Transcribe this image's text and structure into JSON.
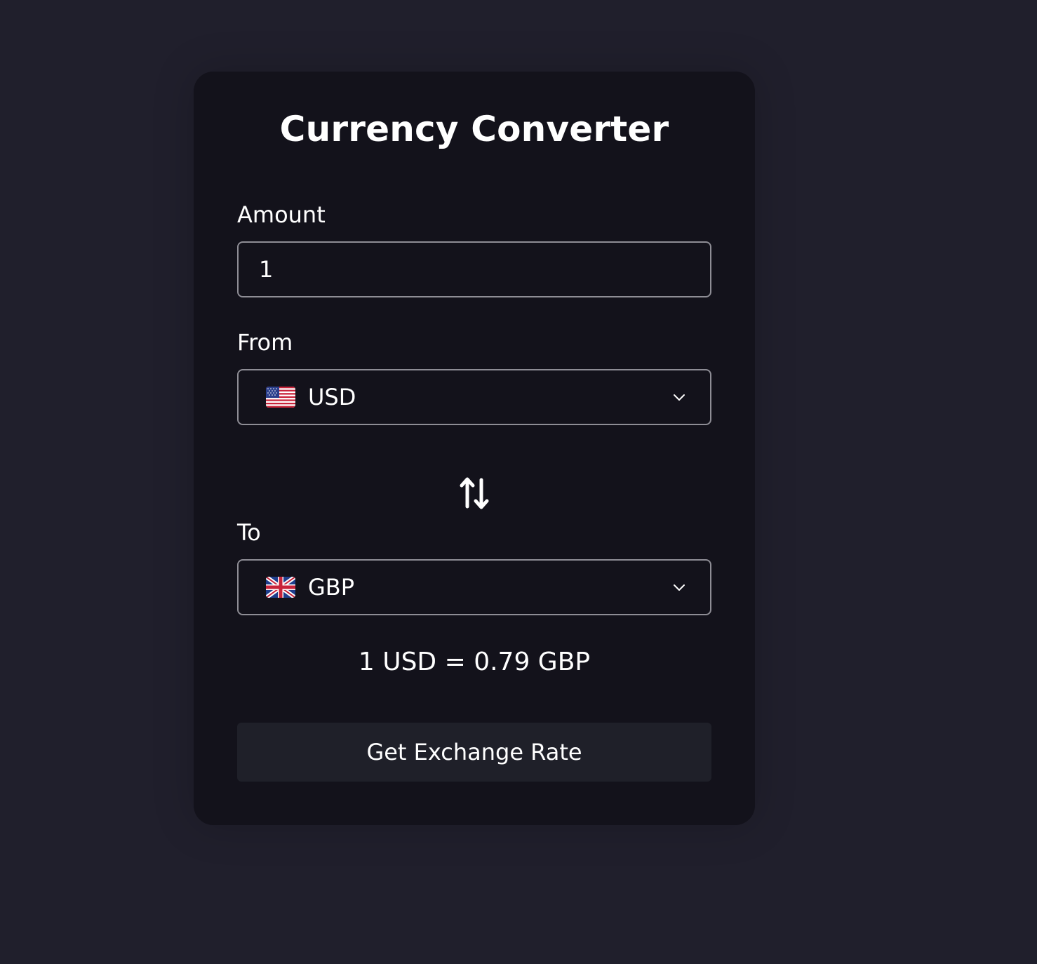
{
  "converter": {
    "title": "Currency Converter",
    "amount_label": "Amount",
    "amount_value": "1",
    "from_label": "From",
    "from_currency": "USD",
    "from_flag": "us-flag-icon",
    "to_label": "To",
    "to_currency": "GBP",
    "to_flag": "uk-flag-icon",
    "swap_icon": "swap-vertical-icon",
    "result_text": "1 USD = 0.79 GBP",
    "button_label": "Get Exchange Rate"
  },
  "colors": {
    "page_background": "#201f2c",
    "card_background": "#13121b",
    "field_border": "#8e8d95",
    "button_background": "#1f2029",
    "text": "#ffffff"
  }
}
